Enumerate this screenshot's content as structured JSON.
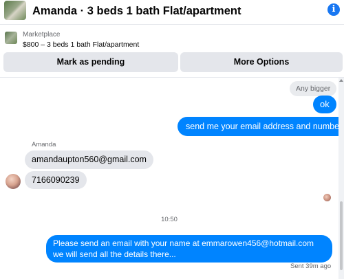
{
  "header": {
    "title": "Amanda · 3 beds 1 bath Flat/apartment",
    "info_icon": "info-icon",
    "accent": "#1877f2"
  },
  "listing": {
    "kicker": "Marketplace",
    "description": "$800 – 3 beds 1 bath Flat/apartment",
    "buttons": {
      "pending": "Mark as pending",
      "options": "More Options"
    }
  },
  "thread": {
    "messages": [
      {
        "from": "other",
        "text": "Any bigger"
      },
      {
        "from": "me",
        "text": "ok"
      },
      {
        "from": "me",
        "text": "send me your email address and number"
      },
      {
        "from": "other",
        "sender": "Amanda",
        "text": "amandaupton560@gmail.com"
      },
      {
        "from": "other",
        "text": "7166090239"
      },
      {
        "from": "me",
        "text": "Please send an email with your name at emmarowen456@hotmail.com we will send all the details there..."
      }
    ],
    "sender_name": "Amanda",
    "timestamp": "10:50",
    "sent_status": "Sent 39m ago"
  },
  "colors": {
    "outgoing_bubble": "#0084ff",
    "incoming_bubble": "#e4e6eb",
    "button_bg": "#e4e6eb"
  }
}
